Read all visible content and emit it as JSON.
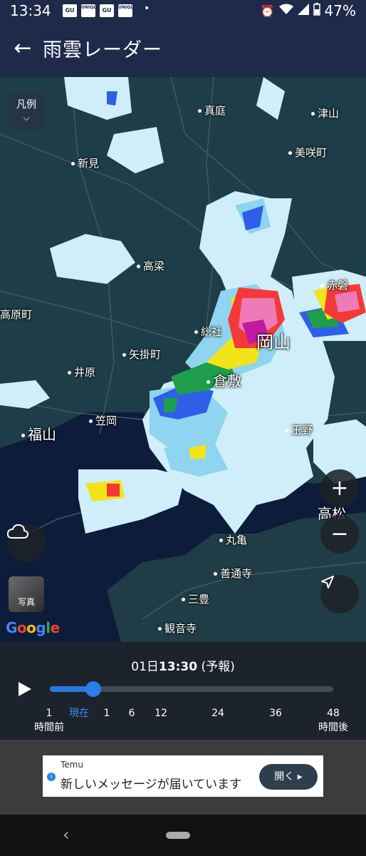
{
  "statusbar": {
    "time": "13:34",
    "notifications": [
      "GU",
      "UNIQLO",
      "GU",
      "UNIQLO"
    ],
    "dot": "•",
    "battery": "47%"
  },
  "appbar": {
    "back_icon": "←",
    "title": "雨雲レーダー"
  },
  "map": {
    "legend_label": "凡例",
    "legend_chevron": "⌵",
    "places": {
      "maniwa": "真庭",
      "tsuyama": "津山",
      "misakicho": "美咲町",
      "niimi": "新見",
      "takahashi": "高梁",
      "akaiwa": "赤磐",
      "takaharacho": "高原町",
      "soja": "総社",
      "okayama": "岡山",
      "yakagecho": "矢掛町",
      "ibara": "井原",
      "kurashiki": "倉敷",
      "kasaoka": "笠岡",
      "fukuyama": "福山",
      "tamano": "玉野",
      "takamatsu": "高松",
      "marugame": "丸亀",
      "zentsuji": "善通寺",
      "mitoyo": "三豊",
      "kanonji": "観音寺"
    },
    "photo_label": "写真",
    "google_logo": "Google",
    "zoom_in_icon": "+",
    "zoom_out_icon": "−"
  },
  "timeline": {
    "date_prefix": "01日",
    "time": "13:30",
    "mode": "(予報)",
    "slider_position_hours": 0.5,
    "ticks": [
      {
        "value": "1",
        "sub": "時間前",
        "hours": -1
      },
      {
        "value": "現在",
        "sub": "",
        "hours": 0
      },
      {
        "value": "1",
        "sub": "",
        "hours": 1
      },
      {
        "value": "6",
        "sub": "",
        "hours": 6
      },
      {
        "value": "12",
        "sub": "",
        "hours": 12
      },
      {
        "value": "24",
        "sub": "",
        "hours": 24
      },
      {
        "value": "36",
        "sub": "",
        "hours": 36
      },
      {
        "value": "48",
        "sub": "時間後",
        "hours": 48
      }
    ]
  },
  "ad": {
    "brand": "Temu",
    "message": "新しいメッセージが届いています",
    "button": "開く ▸"
  },
  "colors": {
    "appbar": "#1f2a4a",
    "accent": "#2b7de9",
    "rain_light": "#c9ebf7",
    "rain_heavy": "#d30d8a"
  }
}
